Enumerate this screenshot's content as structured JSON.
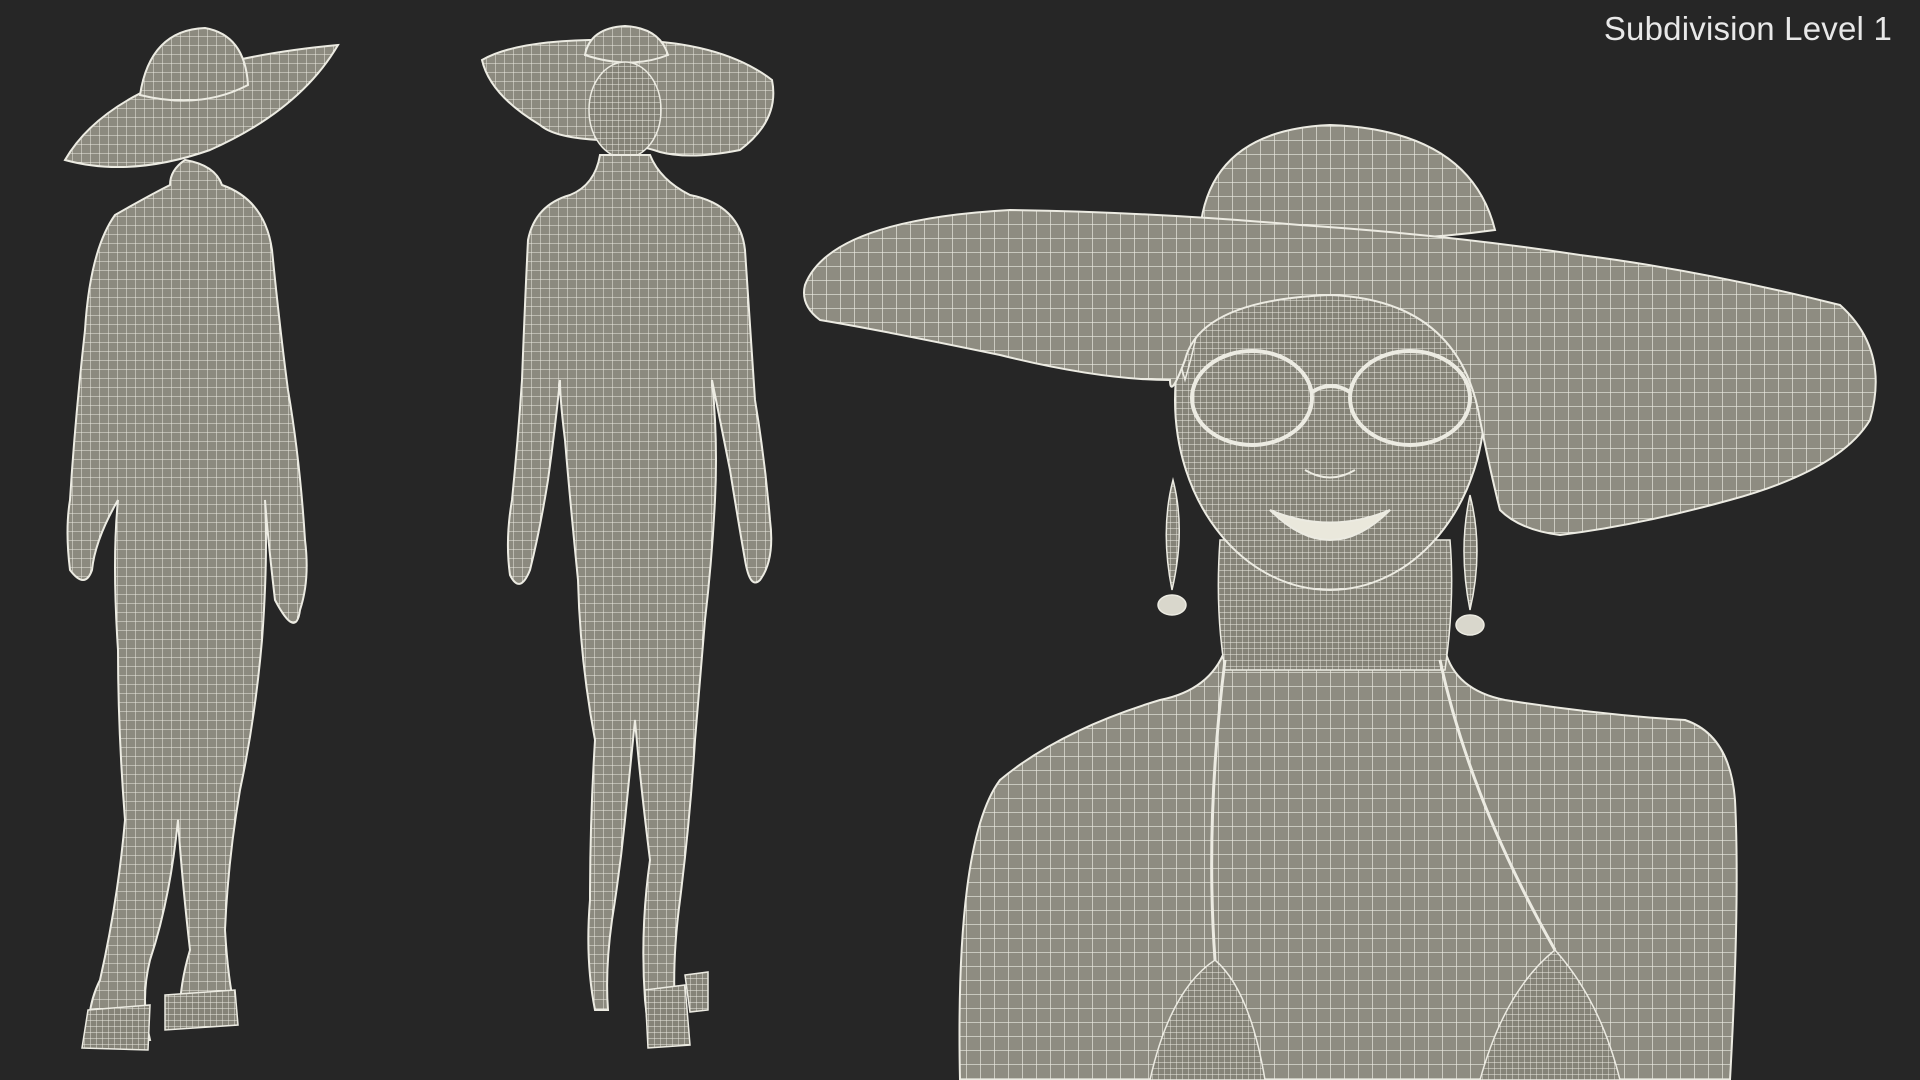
{
  "header": {
    "label": "Subdivision Level 1"
  },
  "render": {
    "background_color": "#262626",
    "mesh_fill_color": "#8c8a7f",
    "wireframe_color": "#ecebe2",
    "views": [
      "back-three-quarter",
      "front-full-body",
      "close-up-head-and-shoulders"
    ]
  }
}
